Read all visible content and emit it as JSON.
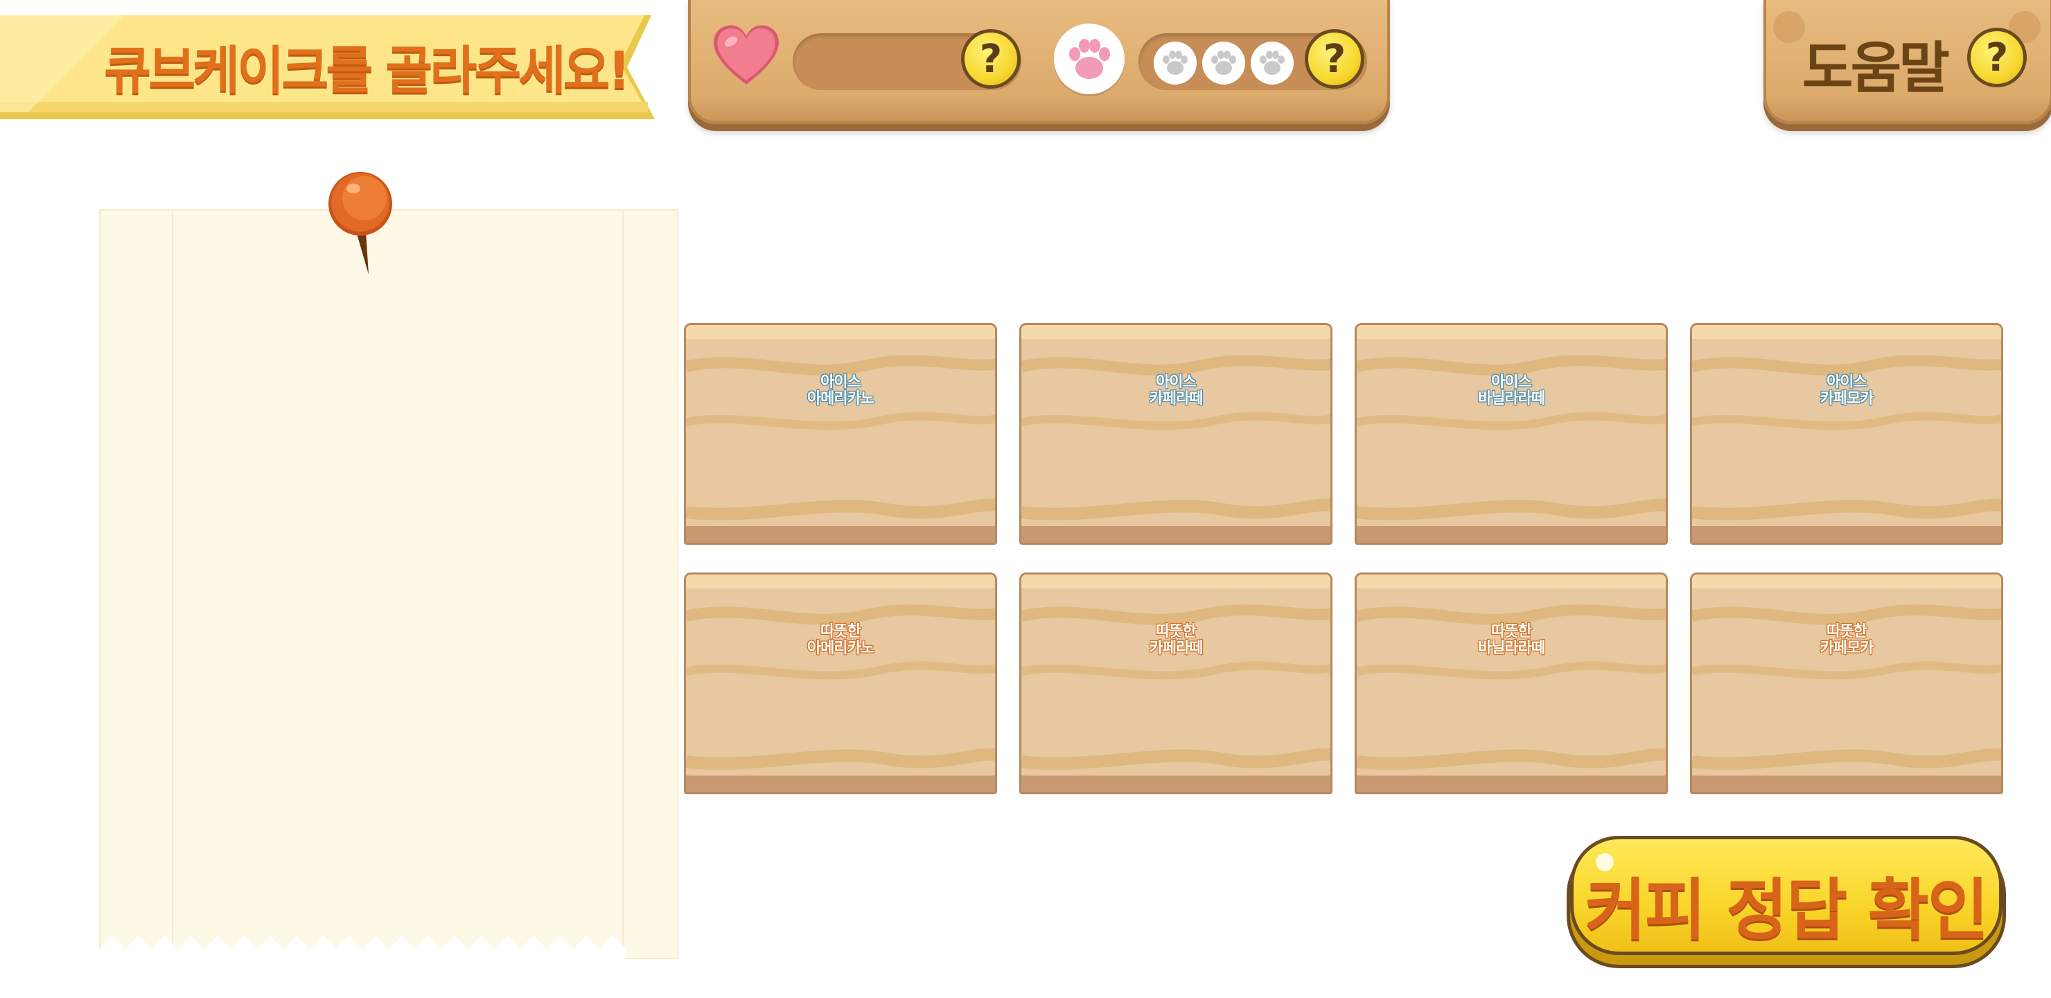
{
  "banner": {
    "title": "큐브케이크를 골라주세요!"
  },
  "status_panel": {
    "lives_help": "?",
    "paws_help": "?",
    "paw_slots": 3
  },
  "help_panel": {
    "label": "도움말",
    "help": "?"
  },
  "cards": [
    {
      "sub": "아이스",
      "name": "아메리카노",
      "kind": "ice"
    },
    {
      "sub": "아이스",
      "name": "카페라떼",
      "kind": "ice"
    },
    {
      "sub": "아이스",
      "name": "바닐라라떼",
      "kind": "ice"
    },
    {
      "sub": "아이스",
      "name": "카페모카",
      "kind": "ice"
    },
    {
      "sub": "따뜻한",
      "name": "아메리카노",
      "kind": "hot"
    },
    {
      "sub": "따뜻한",
      "name": "카페라떼",
      "kind": "hot"
    },
    {
      "sub": "따뜻한",
      "name": "바닐라라떼",
      "kind": "hot"
    },
    {
      "sub": "따뜻한",
      "name": "카페모카",
      "kind": "hot"
    }
  ],
  "confirm_button": {
    "label": "커피 정답 확인"
  },
  "colors": {
    "banner_yellow": "#fde68a",
    "title_orange": "#e0701c",
    "wood": "#dcab6c",
    "button_yellow": "#f9d52a",
    "heart_pink": "#f27d8e",
    "paw_pink": "#f29ab8"
  }
}
